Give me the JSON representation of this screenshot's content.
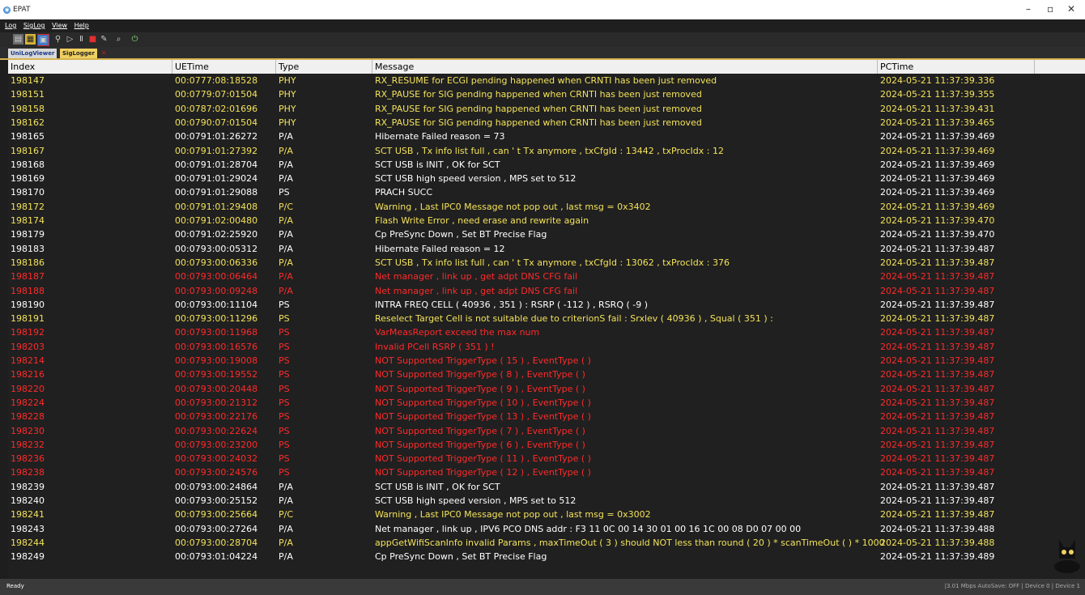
{
  "window": {
    "title": "EPAT"
  },
  "menu": [
    {
      "label": "Log"
    },
    {
      "label": "SigLog"
    },
    {
      "label": "View"
    },
    {
      "label": "Help"
    }
  ],
  "tabs": [
    {
      "label": "UniLogViewer"
    },
    {
      "label": "SigLogger"
    }
  ],
  "colors": {
    "yellow": "#f3e25a",
    "white": "#ffffff",
    "red": "#ff2a2a"
  },
  "table": {
    "headers": [
      "Index",
      "UETime",
      "Type",
      "Message",
      "PCTime"
    ],
    "rows": [
      {
        "index": "198147",
        "uetime": "00:0777:08:18528",
        "type": "PHY",
        "message": "RX_RESUME for ECGI pending happened when CRNTI has been just removed",
        "pctime": "2024-05-21 11:37:39.336",
        "color": "yellow"
      },
      {
        "index": "198151",
        "uetime": "00:0779:07:01504",
        "type": "PHY",
        "message": "RX_PAUSE for SIG pending happened when CRNTI has been just removed",
        "pctime": "2024-05-21 11:37:39.355",
        "color": "yellow"
      },
      {
        "index": "198158",
        "uetime": "00:0787:02:01696",
        "type": "PHY",
        "message": "RX_PAUSE for SIG pending happened when CRNTI has been just removed",
        "pctime": "2024-05-21 11:37:39.431",
        "color": "yellow"
      },
      {
        "index": "198162",
        "uetime": "00:0790:07:01504",
        "type": "PHY",
        "message": "RX_PAUSE for SIG pending happened when CRNTI has been just removed",
        "pctime": "2024-05-21 11:37:39.465",
        "color": "yellow"
      },
      {
        "index": "198165",
        "uetime": "00:0791:01:26272",
        "type": "P/A",
        "message": "Hibernate Failed reason = 73",
        "pctime": "2024-05-21 11:37:39.469",
        "color": "white"
      },
      {
        "index": "198167",
        "uetime": "00:0791:01:27392",
        "type": "P/A",
        "message": "SCT USB , Tx info list full , can ' t Tx anymore , txCfgId : 13442 , txProcIdx : 12",
        "pctime": "2024-05-21 11:37:39.469",
        "color": "yellow"
      },
      {
        "index": "198168",
        "uetime": "00:0791:01:28704",
        "type": "P/A",
        "message": "SCT USB is INIT , OK for SCT",
        "pctime": "2024-05-21 11:37:39.469",
        "color": "white"
      },
      {
        "index": "198169",
        "uetime": "00:0791:01:29024",
        "type": "P/A",
        "message": "SCT USB high speed version , MPS set to 512",
        "pctime": "2024-05-21 11:37:39.469",
        "color": "white"
      },
      {
        "index": "198170",
        "uetime": "00:0791:01:29088",
        "type": "PS",
        "message": "PRACH SUCC",
        "pctime": "2024-05-21 11:37:39.469",
        "color": "white"
      },
      {
        "index": "198172",
        "uetime": "00:0791:01:29408",
        "type": "P/C",
        "message": "Warning , Last IPC0 Message not pop out , last msg = 0x3402",
        "pctime": "2024-05-21 11:37:39.469",
        "color": "yellow"
      },
      {
        "index": "198174",
        "uetime": "00:0791:02:00480",
        "type": "P/A",
        "message": "Flash Write Error , need erase and rewrite again",
        "pctime": "2024-05-21 11:37:39.470",
        "color": "yellow"
      },
      {
        "index": "198179",
        "uetime": "00:0791:02:25920",
        "type": "P/A",
        "message": "Cp PreSync Down , Set BT Precise Flag",
        "pctime": "2024-05-21 11:37:39.470",
        "color": "white"
      },
      {
        "index": "198183",
        "uetime": "00:0793:00:05312",
        "type": "P/A",
        "message": "Hibernate Failed reason = 12",
        "pctime": "2024-05-21 11:37:39.487",
        "color": "white"
      },
      {
        "index": "198186",
        "uetime": "00:0793:00:06336",
        "type": "P/A",
        "message": "SCT USB , Tx info list full , can ' t Tx anymore , txCfgId : 13062 , txProcIdx : 376",
        "pctime": "2024-05-21 11:37:39.487",
        "color": "yellow"
      },
      {
        "index": "198187",
        "uetime": "00:0793:00:06464",
        "type": "P/A",
        "message": "Net manager , link up , get adpt DNS CFG fail",
        "pctime": "2024-05-21 11:37:39.487",
        "color": "red"
      },
      {
        "index": "198188",
        "uetime": "00:0793:00:09248",
        "type": "P/A",
        "message": "Net manager , link up , get adpt DNS CFG fail",
        "pctime": "2024-05-21 11:37:39.487",
        "color": "red"
      },
      {
        "index": "198190",
        "uetime": "00:0793:00:11104",
        "type": "PS",
        "message": "INTRA FREQ CELL ( 40936 , 351 ) : RSRP ( -112 ) , RSRQ ( -9 )",
        "pctime": "2024-05-21 11:37:39.487",
        "color": "white"
      },
      {
        "index": "198191",
        "uetime": "00:0793:00:11296",
        "type": "PS",
        "message": "Reselect Target Cell is not suitable due to criterionS fail : Srxlev ( 40936 ) , Squal ( 351 ) :",
        "pctime": "2024-05-21 11:37:39.487",
        "color": "yellow"
      },
      {
        "index": "198192",
        "uetime": "00:0793:00:11968",
        "type": "PS",
        "message": "VarMeasReport exceed the max num",
        "pctime": "2024-05-21 11:37:39.487",
        "color": "red"
      },
      {
        "index": "198203",
        "uetime": "00:0793:00:16576",
        "type": "PS",
        "message": "Invalid PCell RSRP ( 351 ) !",
        "pctime": "2024-05-21 11:37:39.487",
        "color": "red"
      },
      {
        "index": "198214",
        "uetime": "00:0793:00:19008",
        "type": "PS",
        "message": "NOT Supported TriggerType ( 15 ) , EventType (  )",
        "pctime": "2024-05-21 11:37:39.487",
        "color": "red"
      },
      {
        "index": "198216",
        "uetime": "00:0793:00:19552",
        "type": "PS",
        "message": "NOT Supported TriggerType ( 8 ) , EventType (  )",
        "pctime": "2024-05-21 11:37:39.487",
        "color": "red"
      },
      {
        "index": "198220",
        "uetime": "00:0793:00:20448",
        "type": "PS",
        "message": "NOT Supported TriggerType ( 9 ) , EventType (  )",
        "pctime": "2024-05-21 11:37:39.487",
        "color": "red"
      },
      {
        "index": "198224",
        "uetime": "00:0793:00:21312",
        "type": "PS",
        "message": "NOT Supported TriggerType ( 10 ) , EventType (  )",
        "pctime": "2024-05-21 11:37:39.487",
        "color": "red"
      },
      {
        "index": "198228",
        "uetime": "00:0793:00:22176",
        "type": "PS",
        "message": "NOT Supported TriggerType ( 13 ) , EventType (  )",
        "pctime": "2024-05-21 11:37:39.487",
        "color": "red"
      },
      {
        "index": "198230",
        "uetime": "00:0793:00:22624",
        "type": "PS",
        "message": "NOT Supported TriggerType ( 7 ) , EventType (  )",
        "pctime": "2024-05-21 11:37:39.487",
        "color": "red"
      },
      {
        "index": "198232",
        "uetime": "00:0793:00:23200",
        "type": "PS",
        "message": "NOT Supported TriggerType ( 6 ) , EventType (  )",
        "pctime": "2024-05-21 11:37:39.487",
        "color": "red"
      },
      {
        "index": "198236",
        "uetime": "00:0793:00:24032",
        "type": "PS",
        "message": "NOT Supported TriggerType ( 11 ) , EventType (  )",
        "pctime": "2024-05-21 11:37:39.487",
        "color": "red"
      },
      {
        "index": "198238",
        "uetime": "00:0793:00:24576",
        "type": "PS",
        "message": "NOT Supported TriggerType ( 12 ) , EventType (  )",
        "pctime": "2024-05-21 11:37:39.487",
        "color": "red"
      },
      {
        "index": "198239",
        "uetime": "00:0793:00:24864",
        "type": "P/A",
        "message": "SCT USB is INIT , OK for SCT",
        "pctime": "2024-05-21 11:37:39.487",
        "color": "white"
      },
      {
        "index": "198240",
        "uetime": "00:0793:00:25152",
        "type": "P/A",
        "message": "SCT USB high speed version , MPS set to 512",
        "pctime": "2024-05-21 11:37:39.487",
        "color": "white"
      },
      {
        "index": "198241",
        "uetime": "00:0793:00:25664",
        "type": "P/C",
        "message": "Warning , Last IPC0 Message not pop out , last msg = 0x3002",
        "pctime": "2024-05-21 11:37:39.487",
        "color": "yellow"
      },
      {
        "index": "198243",
        "uetime": "00:0793:00:27264",
        "type": "P/A",
        "message": "Net manager , link up , IPV6 PCO DNS addr : F3 11 0C 00 14 30 01 00 16 1C 00 08 D0 07 00 00",
        "pctime": "2024-05-21 11:37:39.488",
        "color": "white"
      },
      {
        "index": "198244",
        "uetime": "00:0793:00:28704",
        "type": "P/A",
        "message": "appGetWifiScanInfo invalid Params , maxTimeOut ( 3 ) should NOT less than round ( 20 ) * scanTimeOut (  ) * 1000",
        "pctime": "2024-05-21 11:37:39.488",
        "color": "yellow"
      },
      {
        "index": "198249",
        "uetime": "00:0793:01:04224",
        "type": "P/A",
        "message": "Cp PreSync Down , Set BT Precise Flag",
        "pctime": "2024-05-21 11:37:39.489",
        "color": "white"
      }
    ]
  },
  "status": {
    "left": "Ready",
    "right": "|3.01 Mbps  AutoSave: OFF  |  Device 0  |  Device 1"
  }
}
